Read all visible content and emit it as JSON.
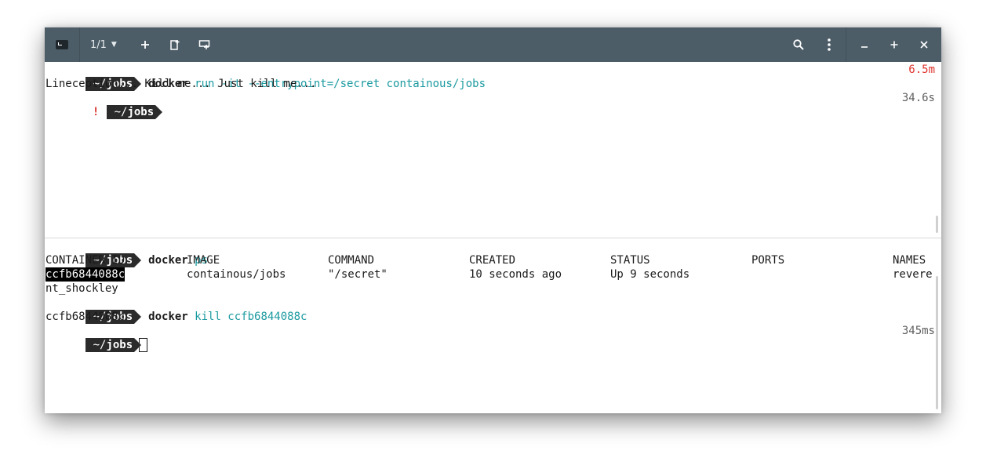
{
  "titlebar": {
    "app_icon": "terminal-icon",
    "tab_counter": "1/1",
    "buttons": {
      "new_tab": "plus-icon",
      "split_vertical": "split-vertical-icon",
      "split_horizontal": "split-horizontal-icon",
      "search": "search-icon",
      "menu": "kebab-menu-icon",
      "minimize": "minimize-icon",
      "maximize": "maximize-icon",
      "close": "close-icon"
    },
    "background_color": "#4d5d68"
  },
  "pane_top": {
    "prompt_dir_tilde": "~/",
    "prompt_dir": "jobs",
    "line1": {
      "cmd": "docker",
      "args": " run -it --entrypoint=/secret containous/jobs",
      "elapsed": "6.5m"
    },
    "output1": "Lineception... Kill me... Just kill me...",
    "line3": {
      "status": "!",
      "elapsed": "34.6s"
    }
  },
  "pane_bottom": {
    "prompt_dir_tilde": "~/",
    "prompt_dir": "jobs",
    "ps_cmd": {
      "cmd": "docker",
      "args": " ps"
    },
    "table": {
      "headers": [
        "CONTAINER ID",
        "IMAGE",
        "COMMAND",
        "CREATED",
        "STATUS",
        "PORTS",
        "NAMES"
      ],
      "row": [
        "ccfb6844088c",
        "containous/jobs",
        "\"/secret\"",
        "10 seconds ago",
        "Up 9 seconds",
        "",
        "revere"
      ],
      "row_wrap": "nt_shockley"
    },
    "kill_cmd": {
      "cmd": "docker",
      "args": " kill ccfb6844088c"
    },
    "kill_output": "ccfb6844088c",
    "last_elapsed": "345ms"
  },
  "colors": {
    "accent_cyan": "#1a9aa0",
    "error_red": "#e0342c",
    "prompt_bg": "#2b2b2b"
  }
}
